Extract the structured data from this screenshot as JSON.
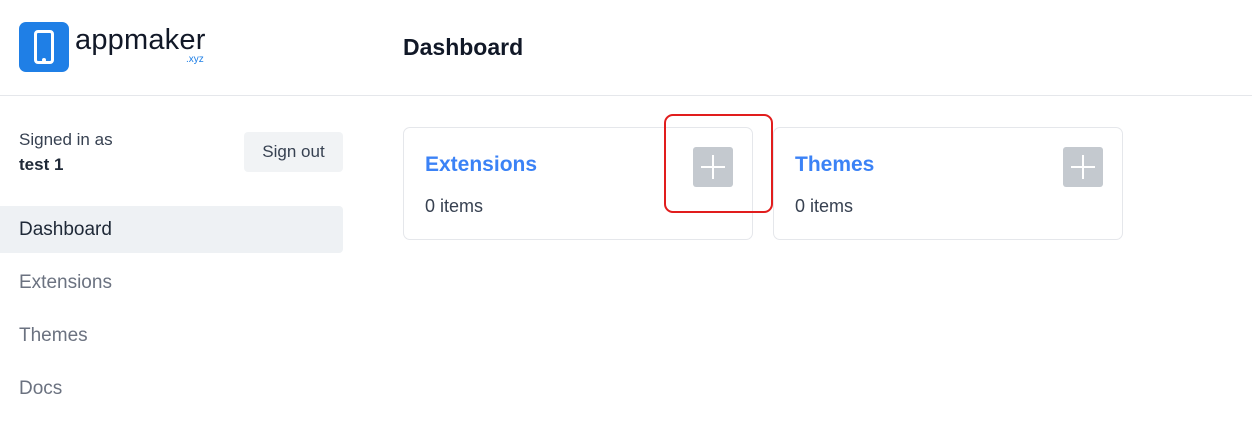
{
  "brand": {
    "name": "appmaker",
    "suffix": ".xyz",
    "icon": "phone-icon",
    "color": "#1f7fe6"
  },
  "header": {
    "title": "Dashboard"
  },
  "sidebar": {
    "signed_in_label": "Signed in as",
    "username": "test 1",
    "sign_out_label": "Sign out",
    "items": [
      {
        "label": "Dashboard",
        "active": true
      },
      {
        "label": "Extensions",
        "active": false
      },
      {
        "label": "Themes",
        "active": false
      },
      {
        "label": "Docs",
        "active": false
      }
    ]
  },
  "cards": [
    {
      "title": "Extensions",
      "count": "0 items",
      "action_icon": "plus-icon"
    },
    {
      "title": "Themes",
      "count": "0 items",
      "action_icon": "plus-icon"
    }
  ],
  "colors": {
    "link": "#3b82f6",
    "highlight": "#e11d1d",
    "add_button": "#c4c9cf"
  }
}
